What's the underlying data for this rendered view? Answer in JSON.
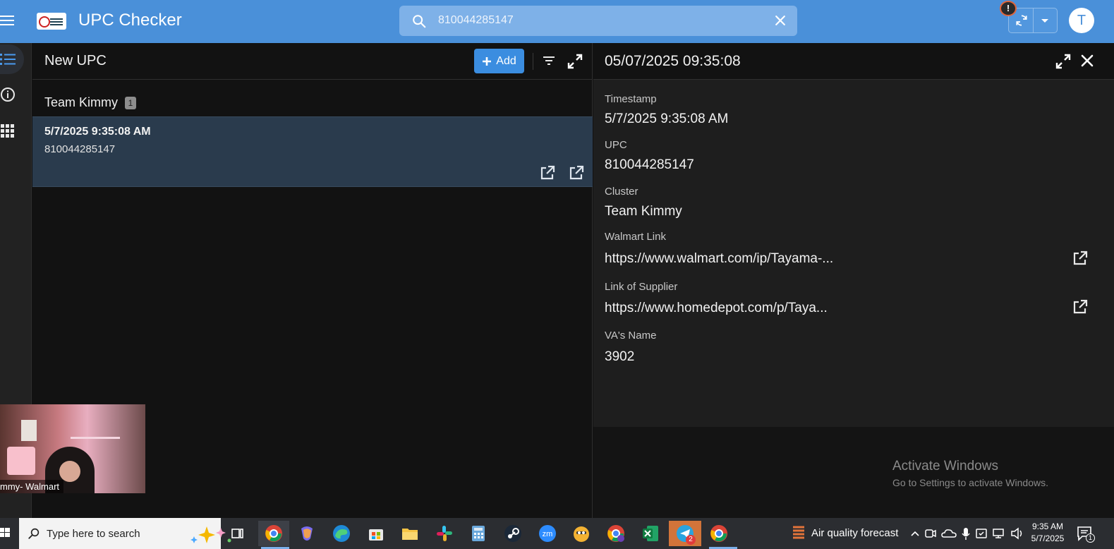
{
  "header": {
    "app_title": "UPC Checker",
    "search_value": "810044285147",
    "alert_symbol": "!",
    "avatar_initial": "T"
  },
  "list_panel": {
    "title": "New UPC",
    "add_label": "Add",
    "group_name": "Team Kimmy",
    "group_count": "1",
    "rows": [
      {
        "title": "5/7/2025 9:35:08 AM",
        "subtitle": "810044285147"
      }
    ]
  },
  "detail_panel": {
    "title": "05/07/2025 09:35:08",
    "fields": [
      {
        "label": "Timestamp",
        "value": "5/7/2025 9:35:08 AM"
      },
      {
        "label": "UPC",
        "value": "810044285147"
      },
      {
        "label": "Cluster",
        "value": "Team Kimmy"
      },
      {
        "label": "Walmart Link",
        "value": "https://www.walmart.com/ip/Tayama-..."
      },
      {
        "label": "Link of Supplier",
        "value": "https://www.homedepot.com/p/Taya..."
      },
      {
        "label": "VA's Name",
        "value": "3902"
      }
    ]
  },
  "watermark": {
    "line1": "Activate Windows",
    "line2": "Go to Settings to activate Windows."
  },
  "webcam": {
    "caption": "mmy- Walmart"
  },
  "taskbar": {
    "search_placeholder": "Type here to search",
    "weather": "Air quality forecast",
    "time": "9:35 AM",
    "date": "5/7/2025",
    "telegram_badge": "2",
    "notification_count": "1"
  },
  "colors": {
    "topbar": "#4a90d9",
    "accent": "#3b8de0",
    "selected_row": "#2a3b4d",
    "panel_bg": "#121212",
    "detail_bg": "#1e1e1e"
  }
}
